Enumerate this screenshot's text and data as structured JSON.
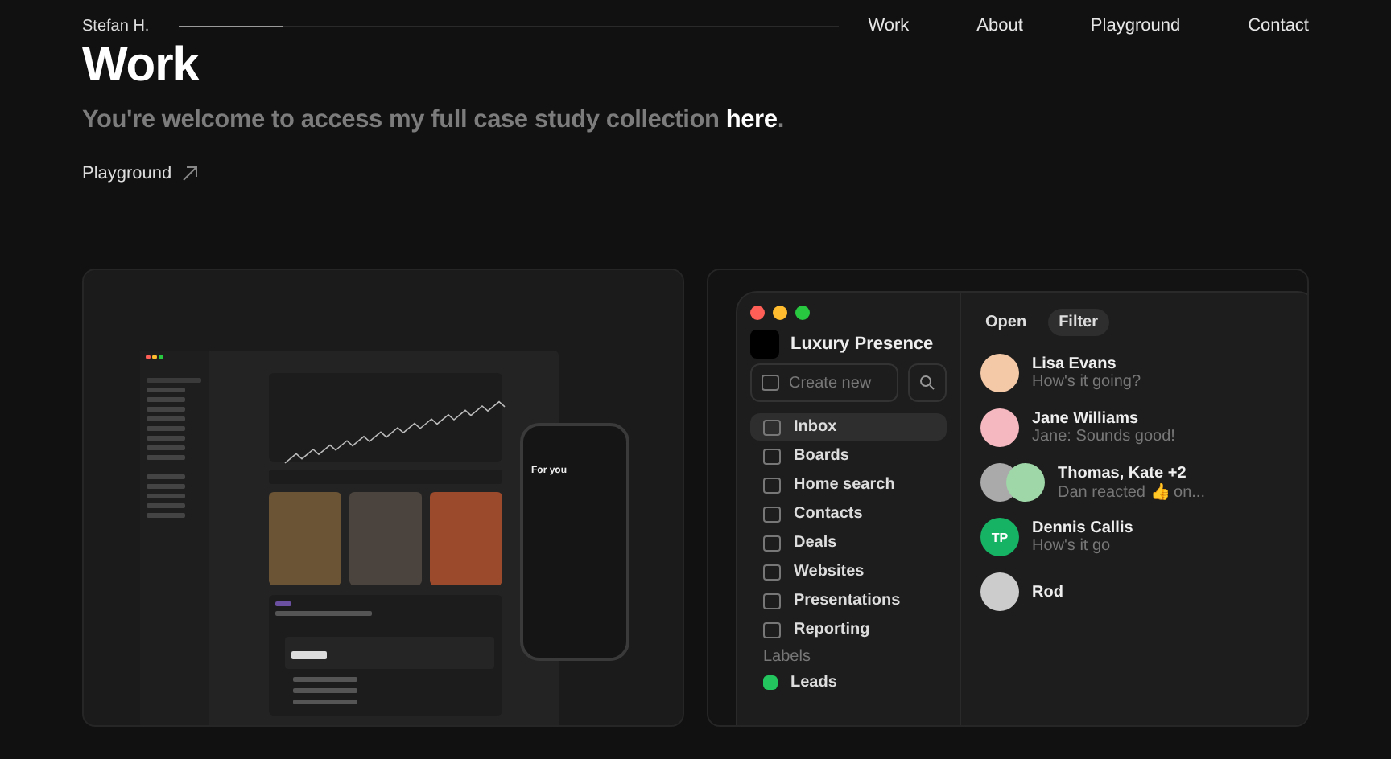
{
  "header": {
    "name": "Stefan H.",
    "scroll_progress": {
      "level": 0.16
    },
    "nav": [
      "Work",
      "About",
      "Playground",
      "Contact"
    ]
  },
  "title": "Work",
  "intro": {
    "text": "You're welcome to access my full case study collection",
    "link": "here",
    "end": "."
  },
  "playground_link": "Playground",
  "cards": [
    {
      "kind": "dashboard",
      "phone_title": "For you"
    },
    {
      "kind": "inbox",
      "app_name": "Luxury Presence",
      "create_placeholder": "Create new",
      "nav": [
        {
          "label": "Inbox",
          "selected": true
        },
        {
          "label": "Boards",
          "selected": false
        },
        {
          "label": "Home search",
          "selected": false
        },
        {
          "label": "Contacts",
          "selected": false
        },
        {
          "label": "Deals",
          "selected": false
        },
        {
          "label": "Websites",
          "selected": false
        },
        {
          "label": "Presentations",
          "selected": false
        },
        {
          "label": "Reporting",
          "selected": false
        }
      ],
      "labels_heading": "Labels",
      "labels": [
        {
          "label": "Leads",
          "color": "#22c55e"
        }
      ],
      "filters": [
        {
          "label": "Open",
          "selected": false
        },
        {
          "label": "Filter",
          "selected": true
        }
      ],
      "messages": [
        {
          "name": "Lisa Evans",
          "preview": "How's it going?",
          "kind": "photo"
        },
        {
          "name": "Jane Williams",
          "preview": "Jane: Sounds good!",
          "kind": "photo"
        },
        {
          "name": "Thomas, Kate +2",
          "preview": "Dan reacted 👍 on...",
          "kind": "group"
        },
        {
          "name": "Dennis Callis",
          "preview": "How's it go",
          "kind": "initials",
          "initials": "TP"
        },
        {
          "name": "Rod",
          "kind": "photo"
        }
      ]
    }
  ]
}
